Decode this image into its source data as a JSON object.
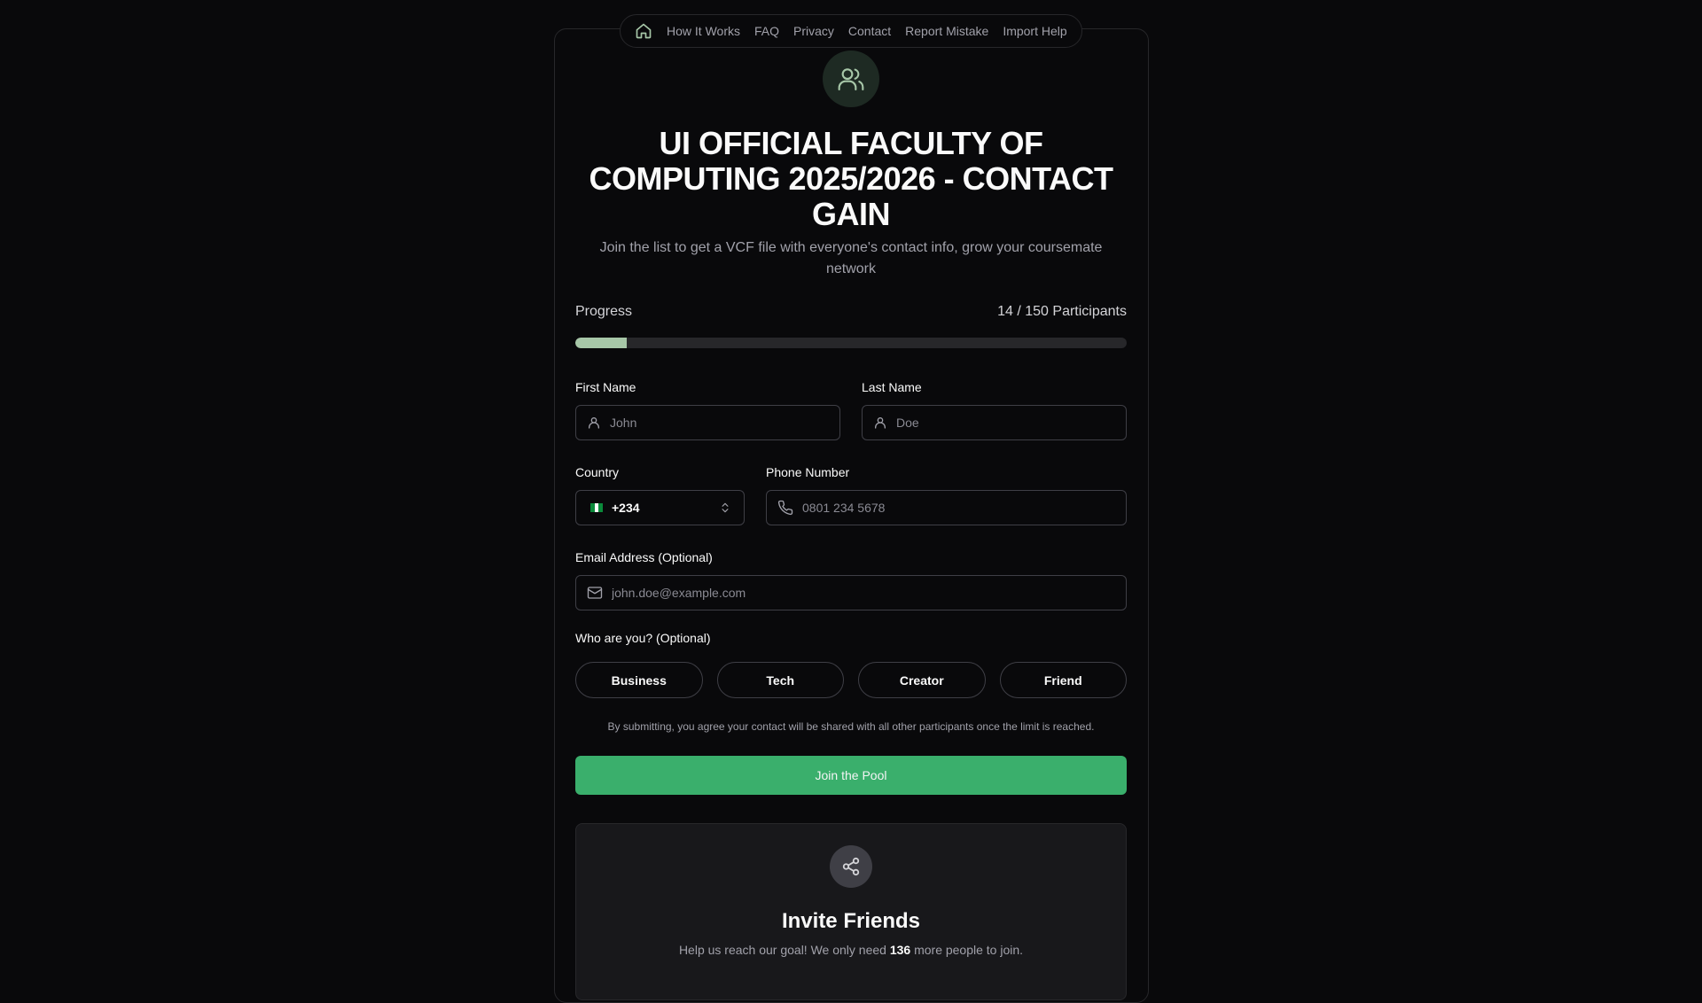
{
  "nav": {
    "items": [
      "How It Works",
      "FAQ",
      "Privacy",
      "Contact",
      "Report Mistake",
      "Import Help"
    ]
  },
  "header": {
    "title": "UI OFFICIAL FACULTY OF COMPUTING 2025/2026 - CONTACT GAIN",
    "subtitle": "Join the list to get a VCF file with everyone's contact info, grow your coursemate network"
  },
  "progress": {
    "label": "Progress",
    "count_text": "14 / 150 Participants",
    "current": 14,
    "total": 150,
    "fill_color": "#a7c7a8"
  },
  "form": {
    "first_name": {
      "label": "First Name",
      "placeholder": "John"
    },
    "last_name": {
      "label": "Last Name",
      "placeholder": "Doe"
    },
    "country": {
      "label": "Country",
      "value": "+234",
      "flag": "nigeria-flag"
    },
    "phone": {
      "label": "Phone Number",
      "placeholder": "0801 234 5678"
    },
    "email": {
      "label": "Email Address (Optional)",
      "placeholder": "john.doe@example.com"
    },
    "role": {
      "label": "Who are you? (Optional)",
      "options": [
        "Business",
        "Tech",
        "Creator",
        "Friend"
      ]
    },
    "disclaimer": "By submitting, you agree your contact will be shared with all other participants once the limit is reached.",
    "submit_label": "Join the Pool",
    "submit_color": "#3aaf6c"
  },
  "invite": {
    "title": "Invite Friends",
    "text_before": "Help us reach our goal! We only need ",
    "remaining": "136",
    "text_after": " more people to join."
  }
}
